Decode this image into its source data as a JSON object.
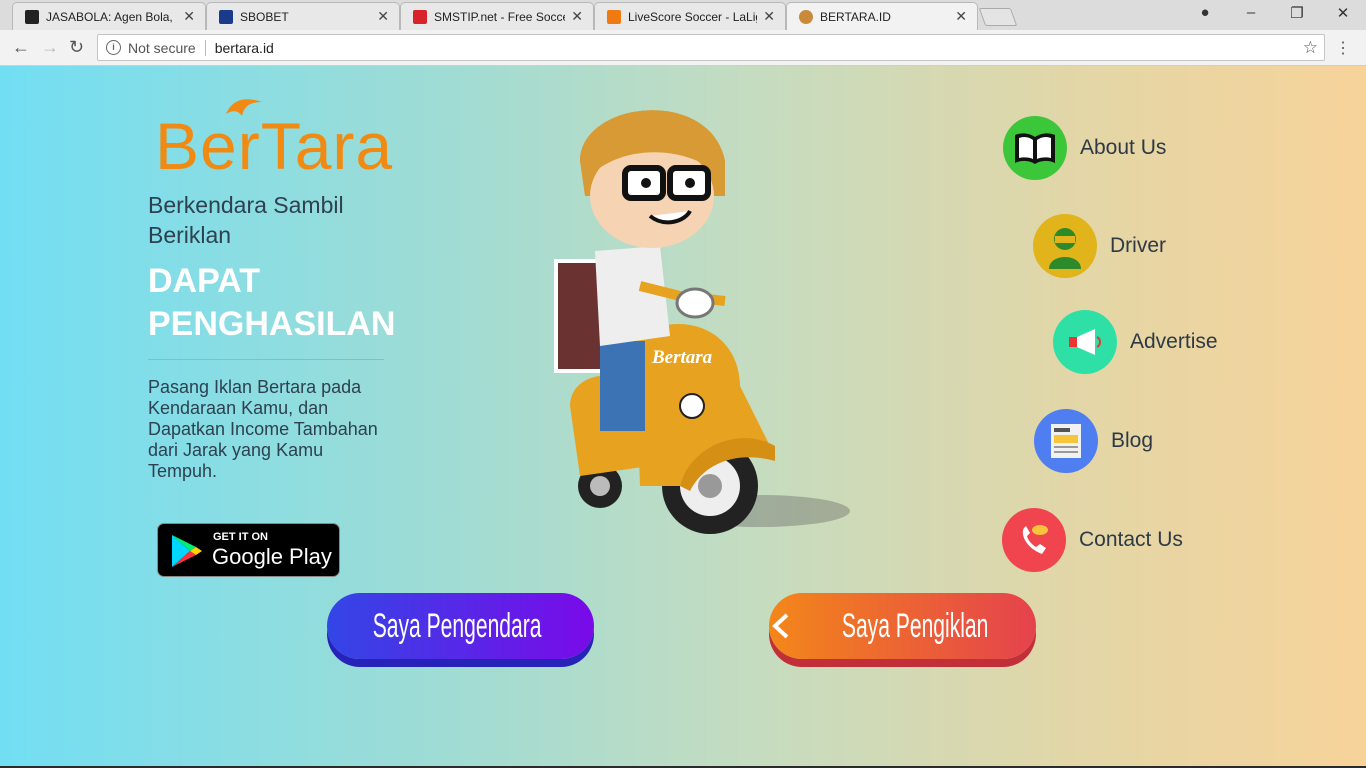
{
  "browser": {
    "tabs": [
      {
        "title": "JASABOLA: Agen Bola, Ba",
        "favicon_color": "#222222"
      },
      {
        "title": "SBOBET",
        "favicon_color": "#1a3a8a"
      },
      {
        "title": "SMSTIP.net - Free Soccer",
        "favicon_color": "#d8232a"
      },
      {
        "title": "LiveScore Soccer - LaLiga",
        "favicon_color": "#f07a12"
      },
      {
        "title": "BERTARA.ID",
        "favicon_color": "#c98a3a"
      }
    ],
    "active_tab": 4,
    "security": "Not secure",
    "url": "bertara.id"
  },
  "page": {
    "logo": "BerTara",
    "tagline": "Berkendara Sambil Beriklan",
    "headline": "DAPAT PENGHASILAN",
    "description": "Pasang Iklan Bertara pada Kendaraan Kamu, dan Dapatkan Income Tambahan dari Jarak yang Kamu Tempuh.",
    "store_badge": {
      "small": "GET IT ON",
      "big": "Google Play"
    },
    "scooter_brand": "Bertara",
    "menu": [
      {
        "label": "About Us",
        "icon": "book-icon",
        "color": "#3cc63a"
      },
      {
        "label": "Driver",
        "icon": "driver-icon",
        "color": "#e0b41a"
      },
      {
        "label": "Advertise",
        "icon": "megaphone-icon",
        "color": "#2ee0a5"
      },
      {
        "label": "Blog",
        "icon": "newspaper-icon",
        "color": "#4f7ef0"
      },
      {
        "label": "Contact Us",
        "icon": "phone-icon",
        "color": "#f0444f"
      }
    ],
    "cta_rider": "Saya Pengendara",
    "cta_advertiser": "Saya Pengiklan"
  }
}
